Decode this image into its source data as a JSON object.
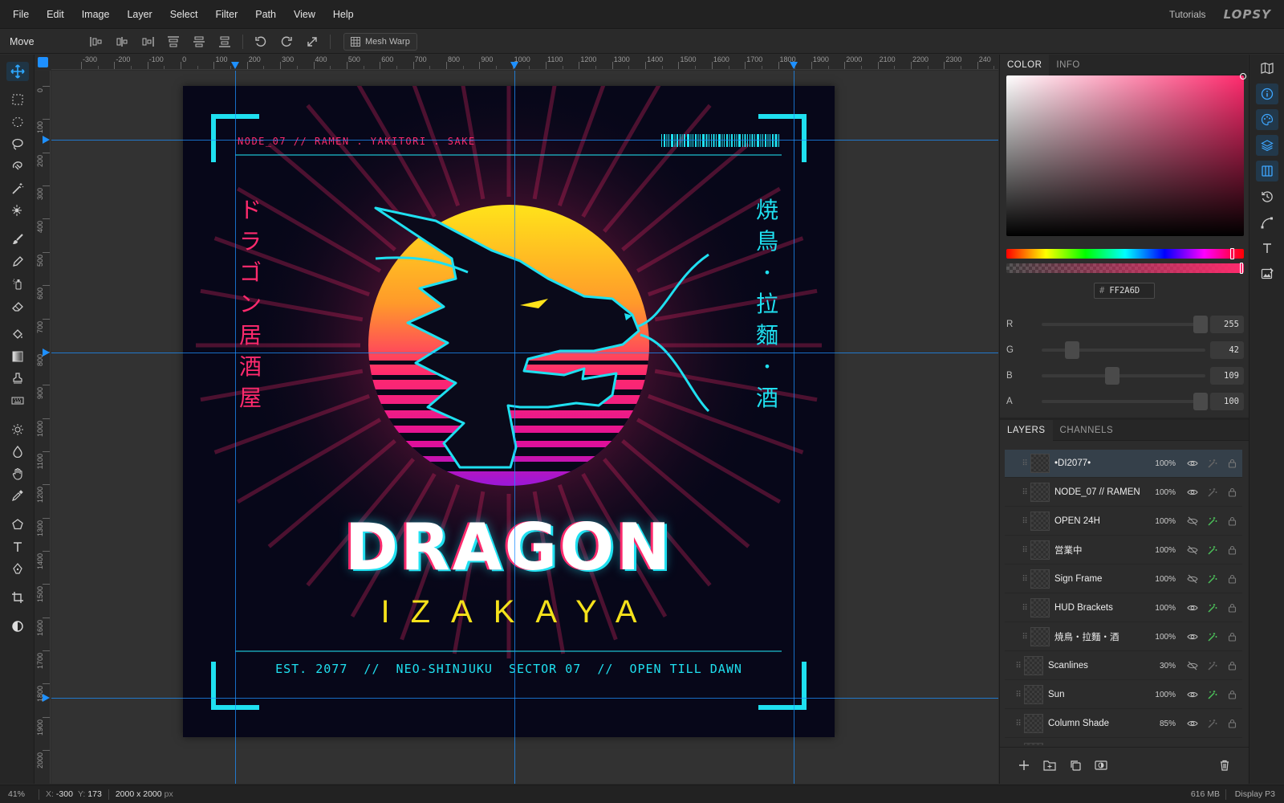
{
  "menu": {
    "items": [
      "File",
      "Edit",
      "Image",
      "Layer",
      "Select",
      "Filter",
      "Path",
      "View",
      "Help"
    ],
    "tutorials": "Tutorials",
    "logo": "LOPSY"
  },
  "options": {
    "tool_name": "Move",
    "mesh_warp": "Mesh Warp"
  },
  "rulers": {
    "h_ticks": [
      "-300",
      "-200",
      "-100",
      "0",
      "100",
      "200",
      "300",
      "400",
      "500",
      "600",
      "700",
      "800",
      "900",
      "1000",
      "1100",
      "1200",
      "1300",
      "1400",
      "1500",
      "1600",
      "1700",
      "1800",
      "1900",
      "2000",
      "2100",
      "2200",
      "2300",
      "240"
    ],
    "v_ticks": [
      "0",
      "100",
      "200",
      "300",
      "400",
      "500",
      "600",
      "700",
      "800",
      "900",
      "1000",
      "1100",
      "1200",
      "1300",
      "1400",
      "1500",
      "1600",
      "1700",
      "1800",
      "1900",
      "2000"
    ]
  },
  "artwork": {
    "header_line": "NODE_07 // RAMEN . YAKITORI . SAKE",
    "vertical_left": [
      "ド",
      "ラ",
      "ゴ",
      "ン",
      "居",
      "酒",
      "屋"
    ],
    "vertical_right": [
      "焼",
      "鳥",
      "•",
      "拉",
      "麵",
      "•",
      "酒"
    ],
    "title": "DRAGON",
    "subtitle": "IZAKAYA",
    "footer_line": "EST. 2077  //  NEO-SHINJUKU  SECTOR 07  //  OPEN TILL DAWN"
  },
  "color_panel": {
    "tabs": [
      "COLOR",
      "INFO"
    ],
    "hex_prefix": "#",
    "hex": "FF2A6D",
    "channels": [
      {
        "label": "R",
        "value": "255",
        "fraction": 1.0
      },
      {
        "label": "G",
        "value": "42",
        "fraction": 0.165
      },
      {
        "label": "B",
        "value": "109",
        "fraction": 0.427
      },
      {
        "label": "A",
        "value": "100",
        "fraction": 1.0
      }
    ]
  },
  "layers_panel": {
    "tabs": [
      "LAYERS",
      "CHANNELS"
    ],
    "layers": [
      {
        "name": "•DI2077•",
        "opacity": "100%",
        "visible": true,
        "fx": false,
        "indent": 1,
        "selected": true
      },
      {
        "name": "NODE_07 // RAMEN",
        "opacity": "100%",
        "visible": true,
        "fx": false,
        "indent": 1
      },
      {
        "name": "OPEN 24H",
        "opacity": "100%",
        "visible": false,
        "fx": true,
        "indent": 1
      },
      {
        "name": "営業中",
        "opacity": "100%",
        "visible": false,
        "fx": true,
        "indent": 1
      },
      {
        "name": "Sign Frame",
        "opacity": "100%",
        "visible": false,
        "fx": true,
        "indent": 1
      },
      {
        "name": "HUD Brackets",
        "opacity": "100%",
        "visible": true,
        "fx": true,
        "indent": 1
      },
      {
        "name": "焼鳥・拉麵・酒",
        "opacity": "100%",
        "visible": true,
        "fx": true,
        "indent": 1
      },
      {
        "name": "Scanlines",
        "opacity": "30%",
        "visible": false,
        "fx": false,
        "indent": 0
      },
      {
        "name": "Sun",
        "opacity": "100%",
        "visible": true,
        "fx": true,
        "indent": 0
      },
      {
        "name": "Column Shade",
        "opacity": "85%",
        "visible": true,
        "fx": false,
        "indent": 0
      }
    ]
  },
  "status": {
    "zoom": "41%",
    "coords_label": "X:",
    "x": "-300",
    "y_label": "Y:",
    "y": "173",
    "size": "2000 x 2000",
    "size_unit": "px",
    "memory": "616 MB",
    "profile": "Display P3"
  },
  "colors": {
    "accent": "#1e90ff",
    "neon_cyan": "#1fe0f0",
    "neon_pink": "#ff2a6d",
    "neon_yellow": "#f5e11b"
  }
}
